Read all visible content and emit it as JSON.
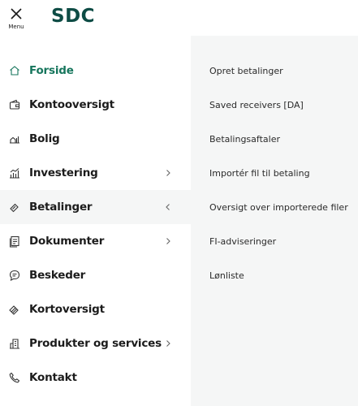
{
  "header": {
    "menu_label": "Menu",
    "logo_text": "SDC"
  },
  "colors": {
    "brand": "#0e4c45",
    "active_text": "#17765d",
    "panel_bg": "#f5f6f6"
  },
  "nav": {
    "items": [
      {
        "label": "Forside",
        "icon": "home-icon",
        "current": true,
        "chevron": "none"
      },
      {
        "label": "Kontooversigt",
        "icon": "wallet-icon",
        "chevron": "none"
      },
      {
        "label": "Bolig",
        "icon": "house-chart-icon",
        "chevron": "none"
      },
      {
        "label": "Investering",
        "icon": "bar-chart-icon",
        "chevron": "right"
      },
      {
        "label": "Betalinger",
        "icon": "payment-icon",
        "chevron": "left",
        "expanded": true
      },
      {
        "label": "Dokumenter",
        "icon": "document-icon",
        "chevron": "right"
      },
      {
        "label": "Beskeder",
        "icon": "chat-icon",
        "chevron": "none"
      },
      {
        "label": "Kortoversigt",
        "icon": "card-icon",
        "chevron": "none"
      },
      {
        "label": "Produkter og services",
        "icon": "building-icon",
        "chevron": "right"
      },
      {
        "label": "Kontakt",
        "icon": "phone-icon",
        "chevron": "none"
      }
    ]
  },
  "submenu": {
    "items": [
      "Opret betalinger",
      "Saved receivers [DA]",
      "Betalingsaftaler",
      "Importér fil til betaling",
      "Oversigt over importerede filer",
      "FI-adviseringer",
      "Lønliste"
    ]
  }
}
